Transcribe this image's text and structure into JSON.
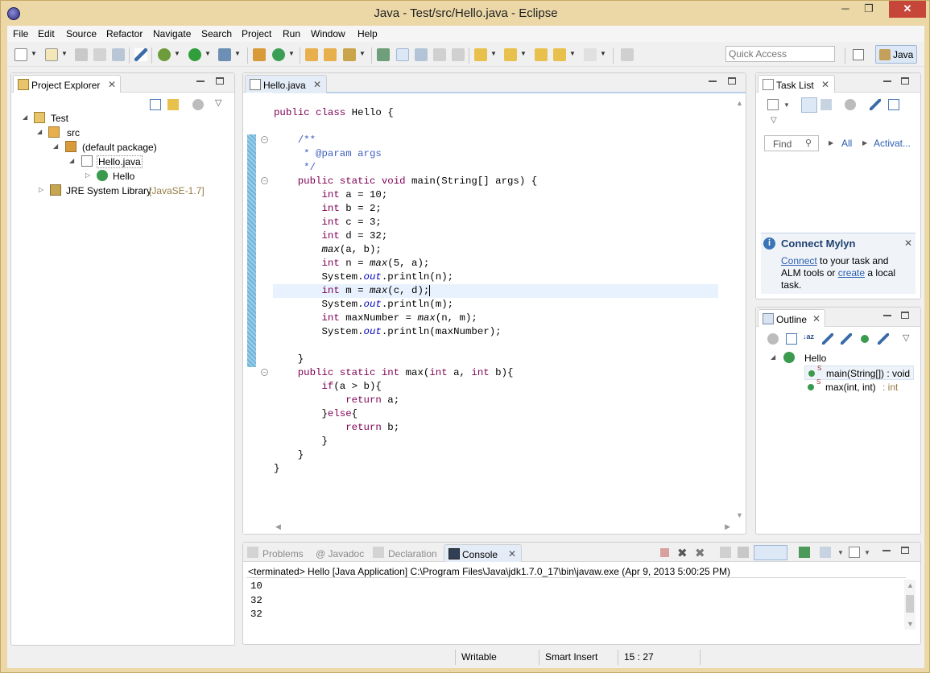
{
  "window": {
    "title": "Java - Test/src/Hello.java - Eclipse",
    "minimize": "─",
    "maximize": "❐",
    "close": "✕"
  },
  "menu": [
    "File",
    "Edit",
    "Source",
    "Refactor",
    "Navigate",
    "Search",
    "Project",
    "Run",
    "Window",
    "Help"
  ],
  "toolbar": {
    "quick_access_placeholder": "Quick Access",
    "perspective": "Java"
  },
  "project_explorer": {
    "title": "Project Explorer",
    "tree": {
      "project": "Test",
      "src": "src",
      "package": "(default package)",
      "file": "Hello.java",
      "class": "Hello",
      "jre": "JRE System Library",
      "jre_version": "[JavaSE-1.7]"
    }
  },
  "editor": {
    "tab": "Hello.java",
    "lines": [
      [],
      [
        {
          "t": "public class ",
          "c": "kw"
        },
        {
          "t": "Hello {",
          "c": ""
        }
      ],
      [],
      [
        {
          "t": "    /**",
          "c": "cm"
        }
      ],
      [
        {
          "t": "     * @param args",
          "c": "cm"
        }
      ],
      [
        {
          "t": "     */",
          "c": "cm"
        }
      ],
      [
        {
          "t": "    public static void ",
          "c": "kw"
        },
        {
          "t": "main(String[] args) {",
          "c": ""
        }
      ],
      [
        {
          "t": "        int ",
          "c": "kw"
        },
        {
          "t": "a = 10;",
          "c": ""
        }
      ],
      [
        {
          "t": "        int ",
          "c": "kw"
        },
        {
          "t": "b = 2;",
          "c": ""
        }
      ],
      [
        {
          "t": "        int ",
          "c": "kw"
        },
        {
          "t": "c = 3;",
          "c": ""
        }
      ],
      [
        {
          "t": "        int ",
          "c": "kw"
        },
        {
          "t": "d = 32;",
          "c": ""
        }
      ],
      [
        {
          "t": "        ",
          "c": ""
        },
        {
          "t": "max",
          "c": "it"
        },
        {
          "t": "(a, b);",
          "c": ""
        }
      ],
      [
        {
          "t": "        int ",
          "c": "kw"
        },
        {
          "t": "n = ",
          "c": ""
        },
        {
          "t": "max",
          "c": "it"
        },
        {
          "t": "(5, a);",
          "c": ""
        }
      ],
      [
        {
          "t": "        System.",
          "c": ""
        },
        {
          "t": "out",
          "c": "fld"
        },
        {
          "t": ".println(n);",
          "c": ""
        }
      ],
      [
        {
          "t": "        int ",
          "c": "kw"
        },
        {
          "t": "m = ",
          "c": ""
        },
        {
          "t": "max",
          "c": "it"
        },
        {
          "t": "(c, d);",
          "c": ""
        }
      ],
      [
        {
          "t": "        System.",
          "c": ""
        },
        {
          "t": "out",
          "c": "fld"
        },
        {
          "t": ".println(m);",
          "c": ""
        }
      ],
      [
        {
          "t": "        int ",
          "c": "kw"
        },
        {
          "t": "maxNumber = ",
          "c": ""
        },
        {
          "t": "max",
          "c": "it"
        },
        {
          "t": "(n, m);",
          "c": ""
        }
      ],
      [
        {
          "t": "        System.",
          "c": ""
        },
        {
          "t": "out",
          "c": "fld"
        },
        {
          "t": ".println(maxNumber);",
          "c": ""
        }
      ],
      [],
      [
        {
          "t": "    }",
          "c": ""
        }
      ],
      [
        {
          "t": "    public static int ",
          "c": "kw"
        },
        {
          "t": "max(",
          "c": ""
        },
        {
          "t": "int ",
          "c": "kw"
        },
        {
          "t": "a, ",
          "c": ""
        },
        {
          "t": "int ",
          "c": "kw"
        },
        {
          "t": "b){",
          "c": ""
        }
      ],
      [
        {
          "t": "        if",
          "c": "kw"
        },
        {
          "t": "(a > b){",
          "c": ""
        }
      ],
      [
        {
          "t": "            return ",
          "c": "kw"
        },
        {
          "t": "a;",
          "c": ""
        }
      ],
      [
        {
          "t": "        }",
          "c": ""
        },
        {
          "t": "else",
          "c": "kw"
        },
        {
          "t": "{",
          "c": ""
        }
      ],
      [
        {
          "t": "            return ",
          "c": "kw"
        },
        {
          "t": "b;",
          "c": ""
        }
      ],
      [
        {
          "t": "        }",
          "c": ""
        }
      ],
      [
        {
          "t": "    }",
          "c": ""
        }
      ],
      [
        {
          "t": "}",
          "c": ""
        }
      ]
    ],
    "current_line": 14
  },
  "task_list": {
    "title": "Task List",
    "find_placeholder": "Find",
    "all": "All",
    "activate": "Activat..."
  },
  "mylyn": {
    "title": "Connect Mylyn",
    "connect": "Connect",
    "text1": " to your task and",
    "text2": "ALM tools or ",
    "create": "create",
    "text3": " a local",
    "text4": "task."
  },
  "outline": {
    "title": "Outline",
    "class": "Hello",
    "main": "main(String[]) : void",
    "max": "max(int, int)",
    "max_type": " : int"
  },
  "bottom": {
    "tabs": [
      "Problems",
      "@ Javadoc",
      "Declaration",
      "Console"
    ],
    "console_header": "<terminated> Hello [Java Application] C:\\Program Files\\Java\\jdk1.7.0_17\\bin\\javaw.exe (Apr 9, 2013 5:00:25 PM)",
    "output": [
      "10",
      "32",
      "32"
    ]
  },
  "status": {
    "writable": "Writable",
    "insert_mode": "Smart Insert",
    "position": "15 : 27"
  }
}
